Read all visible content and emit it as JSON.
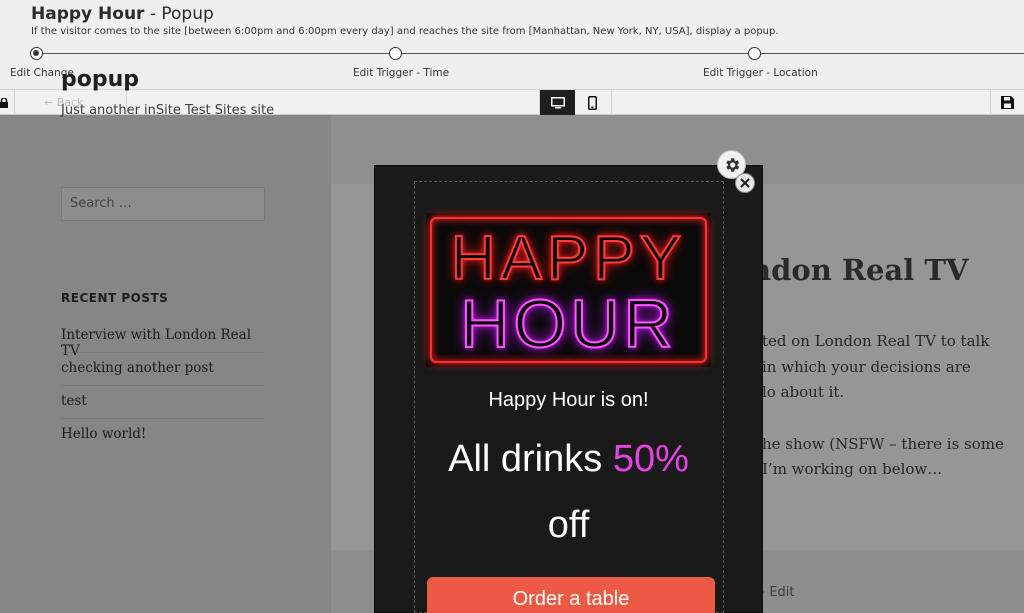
{
  "header": {
    "title_bold": "Happy Hour",
    "title_rest": " - Popup",
    "subtitle": "If the visitor comes to the site [between 6:00pm and 6:00pm every day] and reaches the site from [Manhattan, New York, NY, USA], display a popup.",
    "steps": [
      {
        "label": "Edit Change",
        "active": true
      },
      {
        "label": "Edit Trigger - Time",
        "active": false
      },
      {
        "label": "Edit Trigger - Location",
        "active": false
      }
    ]
  },
  "toolbar": {
    "back_label": "← Back",
    "icons": {
      "desktop": "desktop-icon",
      "mobile": "mobile-icon",
      "save": "save-icon",
      "left": "lock-icon"
    }
  },
  "site": {
    "title": "popup",
    "tagline": "Just another inSite Test Sites site",
    "search_placeholder": "Search …",
    "recent_posts_title": "RECENT POSTS",
    "recent_posts": [
      "Interview with London Real TV",
      "checking another post",
      "test",
      "Hello world!"
    ]
  },
  "article": {
    "title_fragment": "ndon Real TV",
    "lines": [
      "ted on London Real TV to talk",
      "in which your decisions are",
      "lo about it.",
      "he show (NSFW – there is some",
      "I’m working on below…"
    ],
    "edit_label": "Edit"
  },
  "popup": {
    "neon_line1": "HAPPY",
    "neon_line2": "HOUR",
    "headline": "Happy Hour is on!",
    "offer_prefix": "All drinks ",
    "offer_percent": "50%",
    "offer_suffix": "off",
    "cta_label": "Order a table",
    "colors": {
      "accent": "#e544e5",
      "cta": "#ec5a45",
      "background": "#1a1a1a"
    }
  }
}
